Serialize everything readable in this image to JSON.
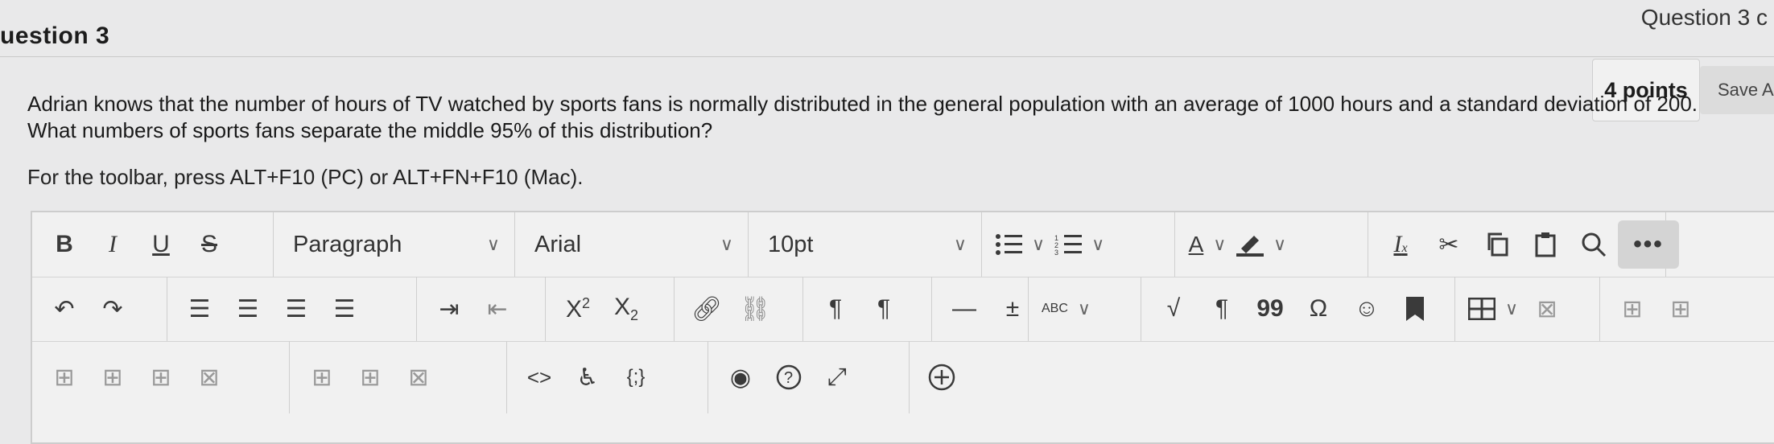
{
  "header": {
    "question_title": "uestion 3",
    "top_right": "Question 3 c"
  },
  "question": {
    "points": "4 points",
    "save_label": "Save A",
    "line1": "Adrian knows that the number of hours of TV watched by sports fans is normally distributed in the general population with an average of 1000 hours and a standard deviation of 200.",
    "line2": "What numbers of sports fans separate the middle 95% of this distribution?"
  },
  "editor": {
    "toolbar_hint": "For the toolbar, press ALT+F10 (PC) or ALT+FN+F10 (Mac).",
    "block_format": "Paragraph",
    "font_family": "Arial",
    "font_size": "10pt",
    "bold_label": "B",
    "italic_label": "I",
    "underline_label": "U",
    "strike_label": "S",
    "more_label": "•••",
    "superscript_label": "X",
    "superscript_mark": "2",
    "subscript_label": "X",
    "subscript_mark": "2",
    "ltr_label": "¶",
    "rtl_label": "¶",
    "spellcheck_label": "ABC",
    "code_label": "<>",
    "math_label": "{;}",
    "paragraph_mark": "¶",
    "quote_label": "99",
    "omega_label": "Ω",
    "font_color_label": "A",
    "minus_label": "—",
    "plusminus_label": "±"
  },
  "colors": {
    "background": "#e9e9ea",
    "toolbar": "#f1f1f1",
    "icon": "#3a3a3a"
  }
}
